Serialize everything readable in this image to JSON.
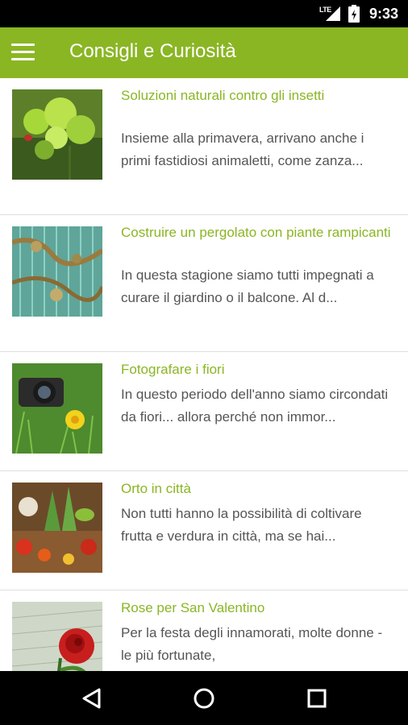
{
  "status_bar": {
    "network": "LTE",
    "time": "9:33"
  },
  "app_bar": {
    "title": "Consigli e Curiosità"
  },
  "articles": [
    {
      "title": "Soluzioni naturali contro gli insetti",
      "excerpt": "Insieme alla primavera, arrivano anche i primi fastidiosi animaletti, come zanza..."
    },
    {
      "title": "Costruire un pergolato con piante rampicanti",
      "excerpt": "In questa stagione siamo tutti impegnati a curare il giardino o il balcone. Al d..."
    },
    {
      "title": "Fotografare i fiori",
      "excerpt": "In questo periodo dell'anno siamo circondati da fiori... allora perché non immor..."
    },
    {
      "title": "Orto in città",
      "excerpt": "Non tutti hanno la possibilità di coltivare frutta e verdura in città, ma se hai..."
    },
    {
      "title": "Rose per San Valentino",
      "excerpt": "Per la festa degli innamorati, molte donne - le più fortunate,"
    }
  ],
  "colors": {
    "accent": "#8ab624",
    "text": "#555555",
    "divider": "#dedede"
  }
}
